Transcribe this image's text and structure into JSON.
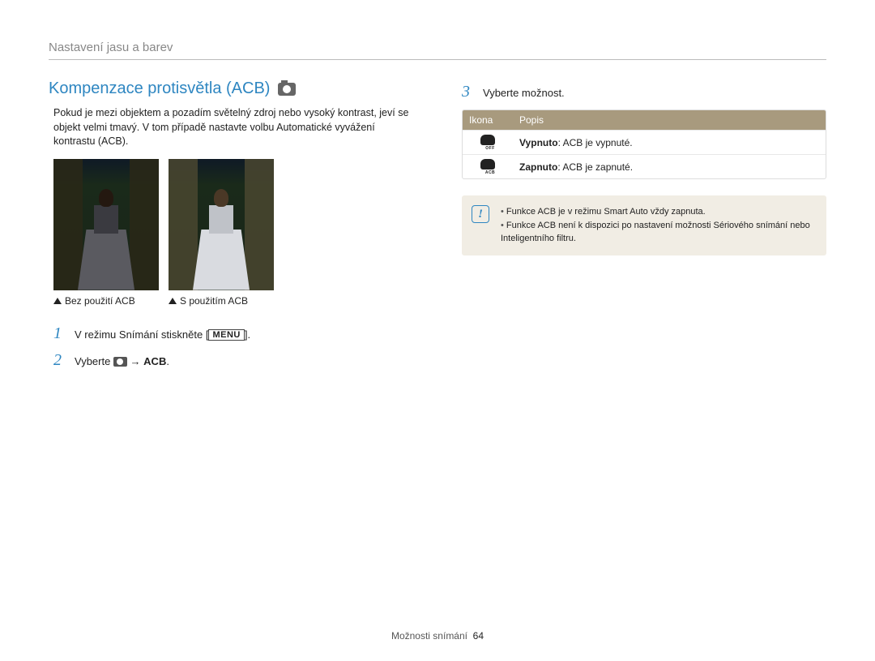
{
  "section_title": "Nastavení jasu a barev",
  "heading": "Kompenzace protisvětla (ACB)",
  "paragraph": "Pokud je mezi objektem a pozadím světelný zdroj nebo vysoký kontrast, jeví se objekt velmi tmavý. V tom případě nastavte volbu Automatické vyvážení kontrastu (ACB).",
  "caption_left": "Bez použití ACB",
  "caption_right": "S použitím ACB",
  "steps": {
    "s1_pre": "V režimu Snímání stiskněte [",
    "s1_menu": "MENU",
    "s1_post": "].",
    "s2_pre": "Vyberte ",
    "s2_post": " → ",
    "s2_bold": "ACB",
    "s2_end": ".",
    "s3": "Vyberte možnost."
  },
  "table": {
    "head_icon": "Ikona",
    "head_desc": "Popis",
    "row1_bold": "Vypnuto",
    "row1_rest": ": ACB je vypnuté.",
    "row2_bold": "Zapnuto",
    "row2_rest": ": ACB je zapnuté."
  },
  "info": {
    "li1": "Funkce ACB je v režimu Smart Auto vždy zapnuta.",
    "li2": "Funkce ACB není k dispozici po nastavení možnosti Sériového snímání nebo Inteligentního filtru."
  },
  "footer": {
    "label": "Možnosti snímání",
    "page": "64"
  }
}
